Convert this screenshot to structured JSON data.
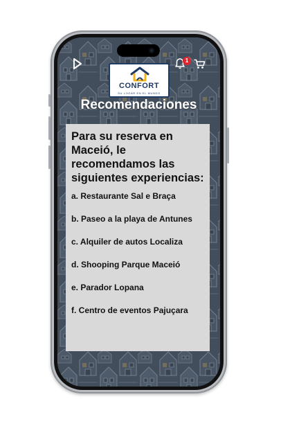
{
  "app": {
    "brand_name": "CONFORT",
    "brand_tagline": "SU LOGAR EN EL MUNDO",
    "notification_count": "1"
  },
  "header": {
    "title": "Recomendaciones"
  },
  "card": {
    "intro": "Para su reserva en Maceió, le recomendamos las siguientes experiencias:",
    "items": [
      "a. Restaurante Sal e Braça",
      "b. Paseo a la playa de Antunes",
      "c. Alquiler de autos Localiza",
      "d. Shooping Parque Maceió",
      "e. Parador Lopana",
      "f. Centro de eventos Pajuçara"
    ]
  },
  "colors": {
    "background": "#44505d",
    "card": "#d9d9d9",
    "badge": "#e0262c",
    "brand_navy": "#1f3a63",
    "brand_yellow": "#f2b31b"
  },
  "icons": {
    "left": "play-icon",
    "notifications": "bell-icon",
    "cart": "cart-icon"
  }
}
